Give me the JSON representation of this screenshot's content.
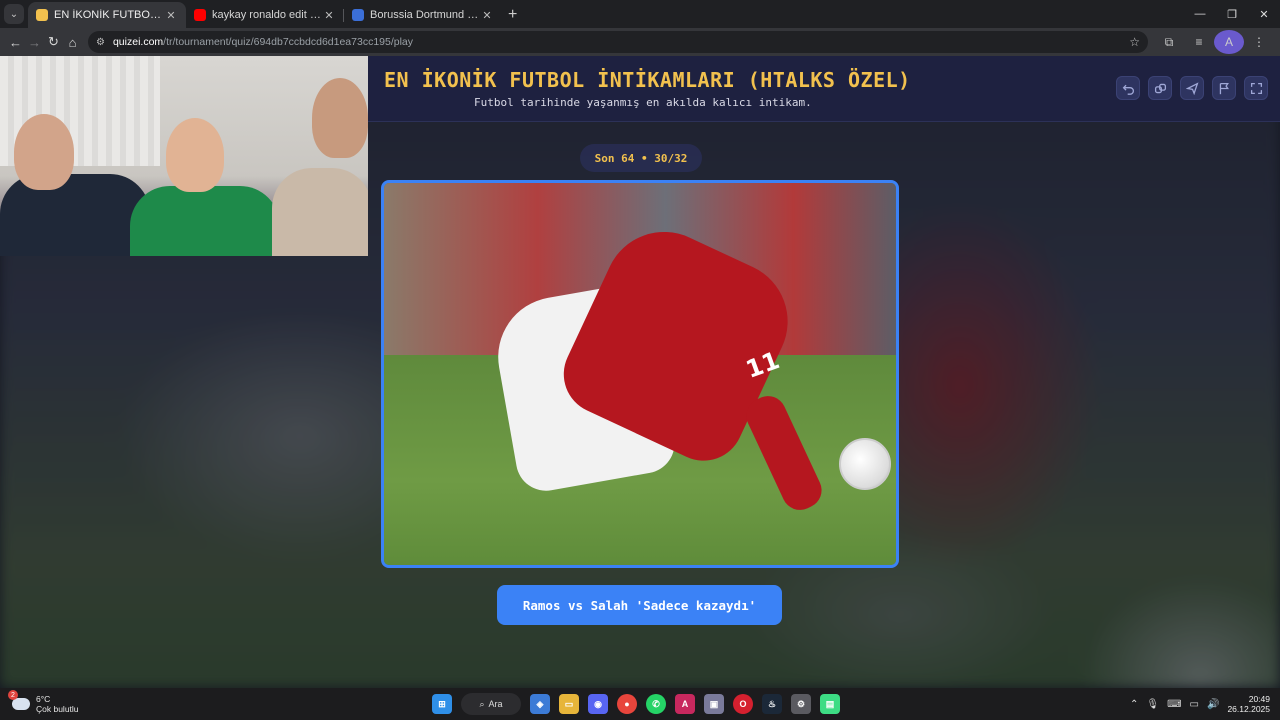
{
  "browser": {
    "tabs": [
      {
        "title": "EN İKONİK FUTBOL İNTİKAMLAI",
        "favicon_color": "#f2c14e",
        "active": true
      },
      {
        "title": "kaykay ronaldo edit - YouTube",
        "favicon_color": "#ff0000",
        "active": false
      },
      {
        "title": "Borussia Dortmund vs Schalke",
        "favicon_color": "#3b6fd8",
        "active": false
      }
    ],
    "url_host": "quizei.com",
    "url_path": "/tr/tournament/quiz/694db7ccbdcd6d1ea73cc195/play",
    "profile_initial": "A"
  },
  "quiz": {
    "title": "EN İKONİK FUTBOL İNTİKAMLARI (HTALKS ÖZEL)",
    "subtitle": "Futbol tarihinde yaşanmış en akılda kalıcı intikam.",
    "round": "Son 64 • 30/32",
    "choice_caption": "Ramos vs Salah 'Sadece kazaydı'",
    "photo_jersey_number": "11",
    "accent_color": "#3b82f6",
    "title_color": "#f2c14e"
  },
  "taskbar": {
    "weather_badge": "2",
    "weather_temp": "6°C",
    "weather_desc": "Çok bulutlu",
    "search_label": "Ara",
    "time": "20:49",
    "date": "26.12.2025"
  }
}
